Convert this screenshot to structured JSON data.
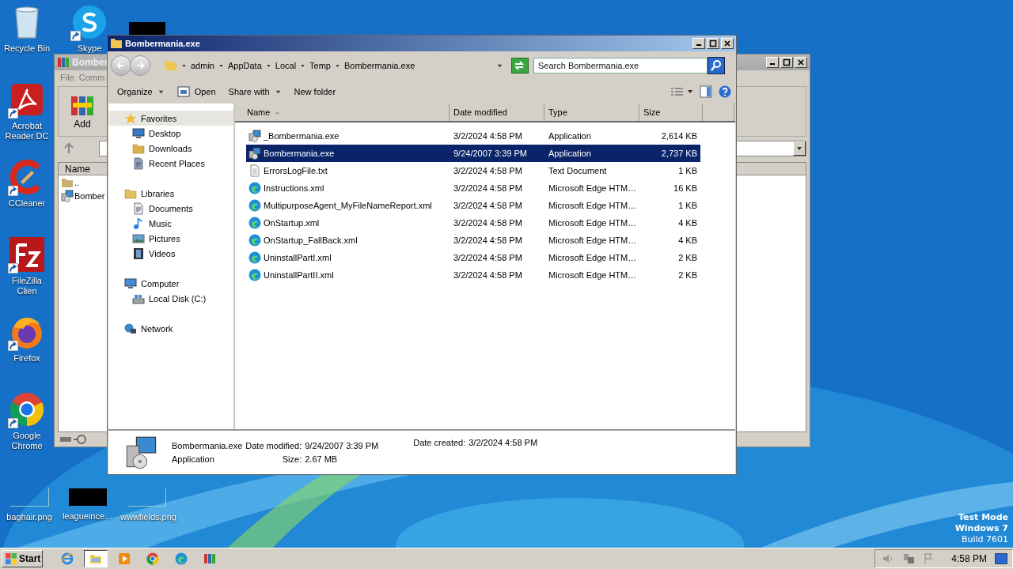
{
  "desktop_icons": [
    {
      "label": "Recycle Bin",
      "kind": "recycle",
      "shortcut": false
    },
    {
      "label": "Acrobat Reader DC",
      "kind": "acrobat",
      "shortcut": true
    },
    {
      "label": "CCleaner",
      "kind": "ccleaner",
      "shortcut": true
    },
    {
      "label": "FileZilla Clien",
      "kind": "filezilla",
      "shortcut": true
    },
    {
      "label": "Firefox",
      "kind": "firefox",
      "shortcut": true
    },
    {
      "label": "Google Chrome",
      "kind": "chrome",
      "shortcut": true
    },
    {
      "label": "Skype",
      "kind": "skype",
      "shortcut": true
    }
  ],
  "desktop_files": [
    {
      "label": "baghair.png",
      "kind": "blank"
    },
    {
      "label": "leagueince…",
      "kind": "dark"
    },
    {
      "label": "wwwfields.png",
      "kind": "blank"
    }
  ],
  "back_window": {
    "title": "Bomber",
    "menu": [
      "File",
      "Comm"
    ],
    "toolbar": [
      "Add"
    ],
    "column": "Name",
    "rows": [
      {
        "name": "..",
        "kind": "up"
      },
      {
        "name": "Bomber",
        "kind": "exe"
      }
    ]
  },
  "explorer": {
    "title": "Bombermania.exe",
    "breadcrumb": [
      "admin",
      "AppData",
      "Local",
      "Temp",
      "Bombermania.exe"
    ],
    "search": {
      "placeholder": "Search Bombermania.exe"
    },
    "commands": [
      {
        "label": "Organize",
        "kind": "menu"
      },
      {
        "label": "Open",
        "kind": "open"
      },
      {
        "label": "Share with",
        "kind": "menu"
      },
      {
        "label": "New folder",
        "kind": "plain"
      }
    ],
    "nav": [
      {
        "label": "Favorites",
        "kind": "star",
        "selected": true,
        "children": [
          {
            "label": "Desktop",
            "kind": "desktop"
          },
          {
            "label": "Downloads",
            "kind": "downloads"
          },
          {
            "label": "Recent Places",
            "kind": "recent"
          }
        ]
      },
      {
        "label": "Libraries",
        "kind": "libraries",
        "selected": false,
        "children": [
          {
            "label": "Documents",
            "kind": "documents"
          },
          {
            "label": "Music",
            "kind": "music"
          },
          {
            "label": "Pictures",
            "kind": "pictures"
          },
          {
            "label": "Videos",
            "kind": "videos"
          }
        ]
      },
      {
        "label": "Computer",
        "kind": "computer",
        "selected": false,
        "children": [
          {
            "label": "Local Disk (C:)",
            "kind": "disk"
          }
        ]
      },
      {
        "label": "Network",
        "kind": "network",
        "selected": false
      }
    ],
    "columns": [
      "Name",
      "Date modified",
      "Type",
      "Size"
    ],
    "files": [
      {
        "name": "_Bombermania.exe",
        "date": "3/2/2024 4:58 PM",
        "type": "Application",
        "size": "2,614 KB",
        "kind": "exe",
        "selected": false
      },
      {
        "name": "Bombermania.exe",
        "date": "9/24/2007 3:39 PM",
        "type": "Application",
        "size": "2,737 KB",
        "kind": "exe",
        "selected": true
      },
      {
        "name": "ErrorsLogFile.txt",
        "date": "3/2/2024 4:58 PM",
        "type": "Text Document",
        "size": "1 KB",
        "kind": "txt",
        "selected": false
      },
      {
        "name": "Instructions.xml",
        "date": "3/2/2024 4:58 PM",
        "type": "Microsoft Edge HTM…",
        "size": "16 KB",
        "kind": "edge",
        "selected": false
      },
      {
        "name": "MultipurposeAgent_MyFileNameReport.xml",
        "date": "3/2/2024 4:58 PM",
        "type": "Microsoft Edge HTM…",
        "size": "1 KB",
        "kind": "edge",
        "selected": false
      },
      {
        "name": "OnStartup.xml",
        "date": "3/2/2024 4:58 PM",
        "type": "Microsoft Edge HTM…",
        "size": "4 KB",
        "kind": "edge",
        "selected": false
      },
      {
        "name": "OnStartup_FallBack.xml",
        "date": "3/2/2024 4:58 PM",
        "type": "Microsoft Edge HTM…",
        "size": "4 KB",
        "kind": "edge",
        "selected": false
      },
      {
        "name": "UninstallPartI.xml",
        "date": "3/2/2024 4:58 PM",
        "type": "Microsoft Edge HTM…",
        "size": "2 KB",
        "kind": "edge",
        "selected": false
      },
      {
        "name": "UninstallPartII.xml",
        "date": "3/2/2024 4:58 PM",
        "type": "Microsoft Edge HTM…",
        "size": "2 KB",
        "kind": "edge",
        "selected": false
      }
    ],
    "details": {
      "name": "Bombermania.exe",
      "type": "Application",
      "modified_label": "Date modified:",
      "modified": "9/24/2007 3:39 PM",
      "size_label": "Size:",
      "size": "2.67 MB",
      "created_label": "Date created:",
      "created": "3/2/2024 4:58 PM"
    }
  },
  "os_notice": [
    "Test Mode",
    "Windows 7",
    "Build 7601"
  ],
  "taskbar": {
    "start": "Start",
    "apps": [
      {
        "kind": "ie",
        "selected": false
      },
      {
        "kind": "explorer",
        "selected": true
      },
      {
        "kind": "media",
        "selected": false
      },
      {
        "kind": "chrome",
        "selected": false
      },
      {
        "kind": "edge",
        "selected": false
      },
      {
        "kind": "winrar",
        "selected": false
      }
    ],
    "clock": "4:58 PM"
  }
}
